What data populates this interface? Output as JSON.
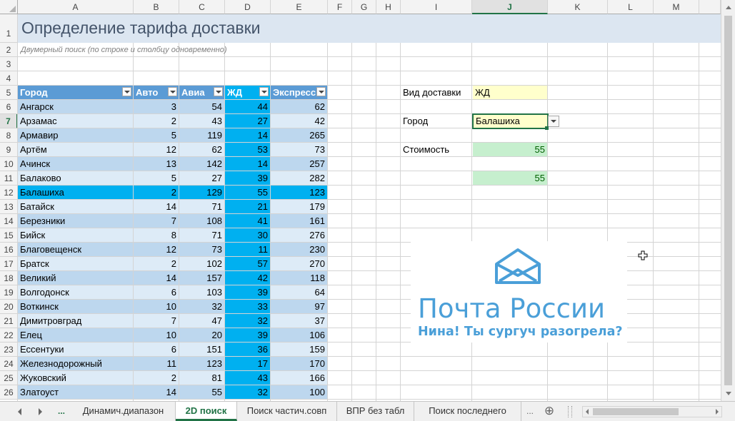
{
  "columns": [
    "A",
    "B",
    "C",
    "D",
    "E",
    "F",
    "G",
    "H",
    "I",
    "J",
    "K",
    "L",
    "M"
  ],
  "selected_column": "J",
  "rows": [
    "1",
    "2",
    "3",
    "4",
    "5",
    "6",
    "7",
    "8",
    "9",
    "10",
    "11",
    "12",
    "13",
    "14",
    "15",
    "16",
    "17",
    "18",
    "19",
    "20",
    "21",
    "22",
    "23",
    "24",
    "25",
    "26"
  ],
  "selected_row": "7",
  "title": "Определение тарифа доставки",
  "subtitle": "Двумерный поиск (по строке и столбцу одновременно)",
  "table": {
    "headers": [
      "Город",
      "Авто",
      "Авиа",
      "ЖД",
      "Экспресс"
    ],
    "rows": [
      [
        "Ангарск",
        "3",
        "54",
        "44",
        "62"
      ],
      [
        "Арзамас",
        "2",
        "43",
        "27",
        "42"
      ],
      [
        "Армавир",
        "5",
        "119",
        "14",
        "265"
      ],
      [
        "Артём",
        "12",
        "62",
        "53",
        "73"
      ],
      [
        "Ачинск",
        "13",
        "142",
        "14",
        "257"
      ],
      [
        "Балаково",
        "5",
        "27",
        "39",
        "282"
      ],
      [
        "Балашиха",
        "2",
        "129",
        "55",
        "123"
      ],
      [
        "Батайск",
        "14",
        "71",
        "21",
        "179"
      ],
      [
        "Березники",
        "7",
        "108",
        "41",
        "161"
      ],
      [
        "Бийск",
        "8",
        "71",
        "30",
        "276"
      ],
      [
        "Благовещенск",
        "12",
        "73",
        "11",
        "230"
      ],
      [
        "Братск",
        "2",
        "102",
        "57",
        "270"
      ],
      [
        "Великий",
        "14",
        "157",
        "42",
        "118"
      ],
      [
        "Волгодонск",
        "6",
        "103",
        "39",
        "64"
      ],
      [
        "Воткинск",
        "10",
        "32",
        "33",
        "97"
      ],
      [
        "Димитровград",
        "7",
        "47",
        "32",
        "37"
      ],
      [
        "Елец",
        "10",
        "20",
        "39",
        "106"
      ],
      [
        "Ессентуки",
        "6",
        "151",
        "36",
        "159"
      ],
      [
        "Железнодорожный",
        "11",
        "123",
        "17",
        "170"
      ],
      [
        "Жуковский",
        "2",
        "81",
        "43",
        "166"
      ],
      [
        "Златоуст",
        "14",
        "55",
        "32",
        "100"
      ]
    ]
  },
  "lookup": {
    "type_label": "Вид доставки",
    "type_value": "ЖД",
    "city_label": "Город",
    "city_value": "Балашиха",
    "cost_label": "Стоимость",
    "cost_value": "55",
    "cost_value2": "55"
  },
  "logo": {
    "name": "Почта России",
    "tagline": "Нина! Ты сургуч разогрела?",
    "color": "#4a9fd8"
  },
  "tabs": {
    "more_left": "...",
    "items": [
      "Динамич.диапазон",
      "2D поиск",
      "Поиск частич.совп",
      "ВПР без табл",
      "Поиск последнего"
    ],
    "active": "2D поиск",
    "more_right": "...",
    "add": "⊕"
  },
  "colors": {
    "header_blue": "#5b9bd5",
    "highlight": "#00b0f0",
    "band_light": "#ddebf7",
    "band_dark": "#bdd7ee",
    "excel_green": "#217346"
  }
}
